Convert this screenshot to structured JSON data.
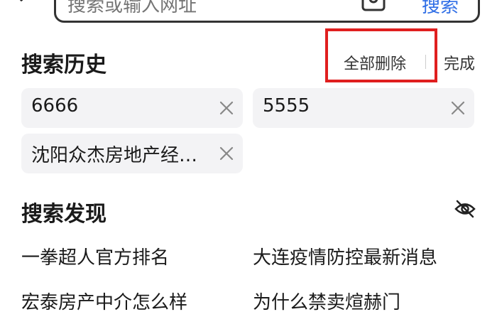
{
  "search": {
    "placeholder": "搜索或输入网址",
    "button_label": "搜索"
  },
  "history": {
    "title": "搜索历史",
    "delete_all_label": "全部删除",
    "done_label": "完成",
    "items": [
      {
        "label": "6666"
      },
      {
        "label": "5555"
      },
      {
        "label": "沈阳众杰房地产经…"
      }
    ]
  },
  "discover": {
    "title": "搜索发现",
    "items": [
      {
        "label": "一拳超人官方排名"
      },
      {
        "label": "大连疫情防控最新消息"
      },
      {
        "label": "宏泰房产中介怎么样"
      },
      {
        "label": "为什么禁卖煊赫门"
      }
    ]
  },
  "icons": {
    "back": "chevron-left-icon",
    "camera": "camera-icon",
    "close": "close-icon",
    "hide": "eye-off-icon"
  },
  "colors": {
    "accent": "#2f6ee6",
    "highlight": "#e01f1f",
    "chip_bg": "#f3f3f5"
  }
}
